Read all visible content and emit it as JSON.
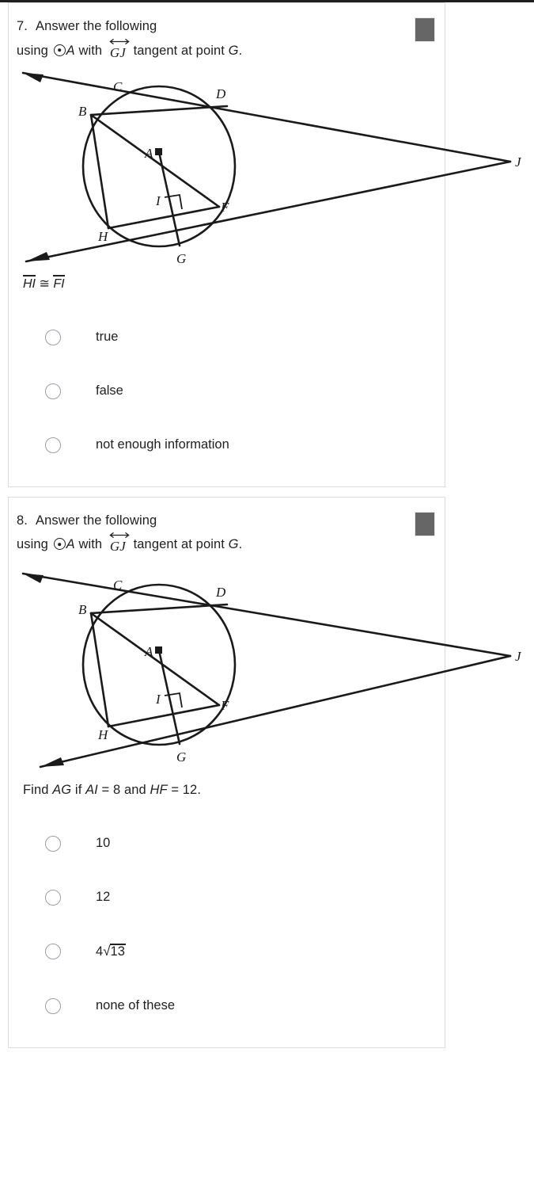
{
  "page": {
    "background": "#ffffff",
    "text_color": "#202124",
    "card_border": "#dcdcdc",
    "thumb_color": "#666666",
    "radio_border": "#9aa0a6"
  },
  "questions": [
    {
      "number": "7.",
      "stem_line1": "Answer the following",
      "stem_line2_pre": "using",
      "stem_circle_label": "A",
      "stem_with": "with",
      "stem_line_notation": "GJ",
      "stem_line2_post": "tangent at point",
      "stem_point": "G",
      "stem_period": ".",
      "thumbnail": "image-placeholder-icon",
      "figure": {
        "name": "circle-a-tangent-gj-diagram",
        "circle_center_label": "A",
        "point_labels": [
          "B",
          "C",
          "D",
          "F",
          "G",
          "H",
          "I",
          "J"
        ],
        "tangent_line": "GJ",
        "secant_line": "CDJ",
        "chords": [
          "BD",
          "BF",
          "BH",
          "HF"
        ],
        "radius_segment": "AG",
        "right_angle_at": "I"
      },
      "assertion": {
        "left": "HI",
        "relation": "≅",
        "right": "FI"
      },
      "options": [
        {
          "label": "true",
          "selected": false
        },
        {
          "label": "false",
          "selected": false
        },
        {
          "label": "not enough information",
          "selected": false
        }
      ]
    },
    {
      "number": "8.",
      "stem_line1": "Answer the following",
      "stem_line2_pre": "using",
      "stem_circle_label": "A",
      "stem_with": "with",
      "stem_line_notation": "GJ",
      "stem_line2_post": "tangent at point",
      "stem_point": "G",
      "stem_period": ".",
      "thumbnail": "image-placeholder-icon",
      "figure": {
        "name": "circle-a-tangent-gj-diagram",
        "circle_center_label": "A",
        "point_labels": [
          "B",
          "C",
          "D",
          "F",
          "G",
          "H",
          "I",
          "J"
        ],
        "tangent_line": "GJ",
        "secant_line": "CDJ",
        "chords": [
          "BD",
          "BF",
          "BH",
          "HF"
        ],
        "radius_segment": "AG",
        "right_angle_at": "I"
      },
      "prompt": {
        "pre": "Find",
        "target": "AG",
        "mid1": "if",
        "given1_var": "AI",
        "given1_eq": "= 8",
        "mid2": "and",
        "given2_var": "HF",
        "given2_eq": "= 12."
      },
      "options": [
        {
          "label": "10",
          "selected": false
        },
        {
          "label": "12",
          "selected": false
        },
        {
          "label": "4√13",
          "radical": {
            "coefficient": "4",
            "radicand": "13"
          },
          "selected": false
        },
        {
          "label": "none of these",
          "selected": false
        }
      ]
    }
  ]
}
